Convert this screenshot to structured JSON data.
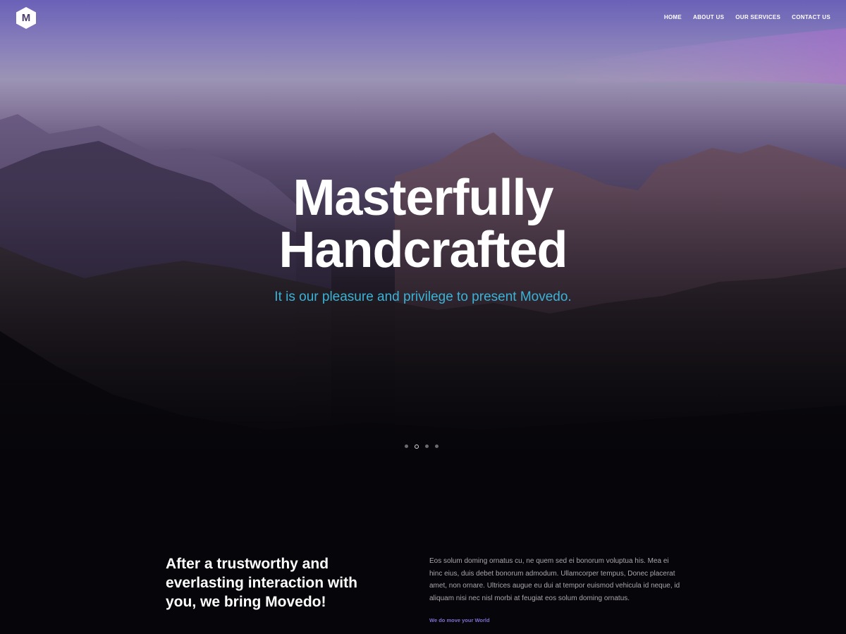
{
  "brand": {
    "logo_letter": "M",
    "icon": "hexagon-logo-icon"
  },
  "nav": {
    "items": [
      {
        "label": "HOME"
      },
      {
        "label": "ABOUT US"
      },
      {
        "label": "OUR SERVICES"
      },
      {
        "label": "CONTACT US"
      }
    ]
  },
  "hero": {
    "title_line1": "Masterfully",
    "title_line2": "Handcrafted",
    "subtitle": "It is our pleasure and privilege to present Movedo.",
    "slider": {
      "total_slides": 4,
      "active_slide": 2
    }
  },
  "intro": {
    "heading": "After a trustworthy and everlasting interaction with you, we bring Movedo!",
    "body": "Eos solum doming ornatus cu, ne quem sed ei bonorum voluptua his. Mea ei hinc eius, duis debet bonorum admodum. Ullamcorper tempus, Donec placerat amet, non ornare. Ultrices augue eu dui at tempor euismod vehicula id neque, id aliquam nisi nec nisl morbi at feugiat eos solum doming ornatus.",
    "link": "We do move your World"
  },
  "colors": {
    "page_background": "#060509",
    "subtitle": "#3ab3d6",
    "link_accent": "#7e6fd0",
    "sky_purple": "#6a61b8"
  }
}
